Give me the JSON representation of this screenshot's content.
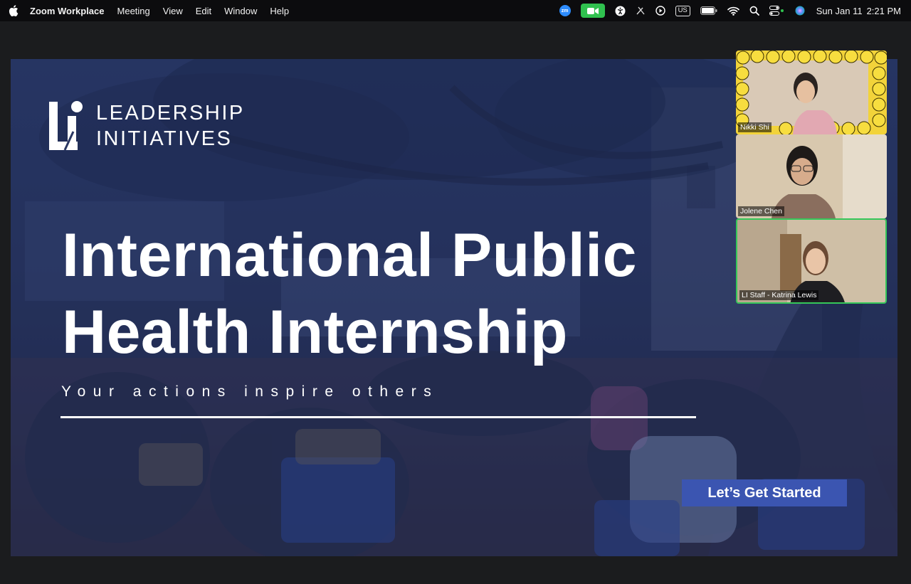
{
  "menubar": {
    "app_name": "Zoom Workplace",
    "menus": [
      "Meeting",
      "View",
      "Edit",
      "Window",
      "Help"
    ],
    "status": {
      "zoom_badge": "zm",
      "keyboard_layout": "US",
      "date": "Sun Jan 11",
      "time": "2:21 PM"
    },
    "icons": [
      "apple-icon",
      "zoom-icon",
      "video-camera-icon",
      "accessibility-icon",
      "pen-off-icon",
      "play-icon",
      "keyboard-layout-icon",
      "battery-icon",
      "wifi-icon",
      "search-icon",
      "control-center-icon",
      "siri-icon"
    ]
  },
  "slide": {
    "logo": {
      "line1": "LEADERSHIP",
      "line2": "INITIATIVES"
    },
    "title_line1": "International Public",
    "title_line2": "Health Internship",
    "tagline": "Your actions inspire others",
    "cta": "Let’s Get Started"
  },
  "participants": [
    {
      "name": "Nikki Shi",
      "background": "emoji-border"
    },
    {
      "name": "Jolene Chen",
      "background": "room"
    },
    {
      "name": "LI Staff - Katrina Lewis",
      "background": "room",
      "active_speaker": true
    }
  ],
  "colors": {
    "menubar": "#0c0c0e",
    "window": "#1b1c1e",
    "slide_overlay": "#2a3763",
    "cta": "#3b55b1",
    "active_speaker": "#35c759",
    "camera_on": "#30c14f"
  }
}
